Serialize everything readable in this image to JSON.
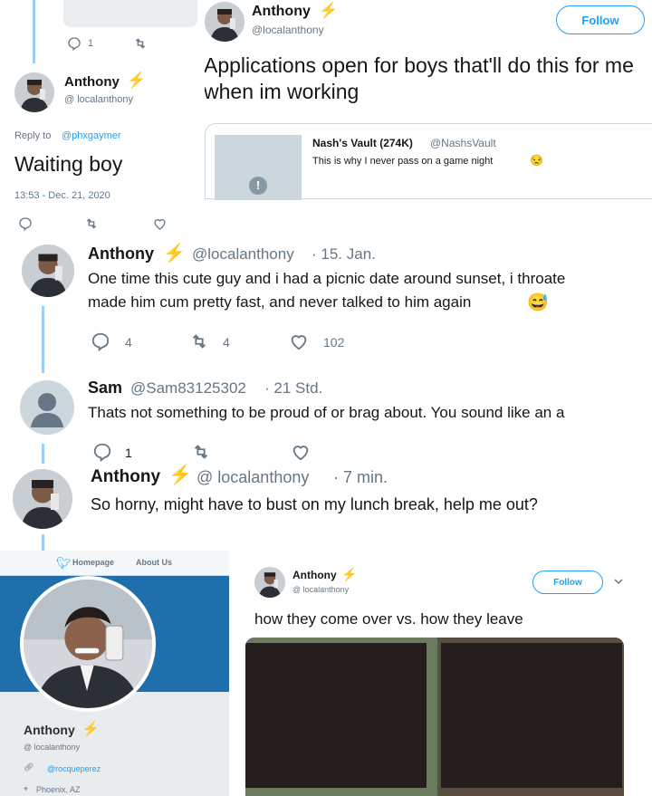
{
  "top_left": {
    "reply_count": "1"
  },
  "tweet1": {
    "name": "Anthony",
    "bolt": "⚡",
    "handle": "@localanthony",
    "follow": "Follow",
    "text": "Applications open for boys that'll do this for me when im working",
    "quote": {
      "name": "Nash's Vault (274K)",
      "handle": "@NashsVault",
      "text": "This is why I never pass on a game night",
      "emoji": "😒"
    }
  },
  "tweet2": {
    "name": "Anthony",
    "bolt": "⚡",
    "handle": "@ localanthony",
    "reply_label": "Reply to",
    "reply_to": "@phxgaymer",
    "text": "Waiting boy",
    "timestamp": "13:53 - Dec. 21, 2020"
  },
  "tweet3": {
    "name": "Anthony",
    "bolt": "⚡",
    "handle": "@localanthony",
    "time": "· 15. Jan.",
    "text_line1": "One time this cute guy and i had a picnic date around sunset, i throate",
    "text_line2": "made him cum pretty fast, and never talked to him again",
    "emoji": "😅",
    "replies": "4",
    "retweets": "4",
    "likes": "102"
  },
  "tweet4": {
    "name": "Sam",
    "handle": "@Sam83125302",
    "time": "· 21 Std.",
    "text": "Thats not something to be proud of or brag about. You sound like an a",
    "replies": "1"
  },
  "tweet5": {
    "name": "Anthony",
    "bolt": "⚡",
    "handle": "@ localanthony",
    "time": "· 7 min.",
    "text": "So horny, might have to bust on my lunch break, help me out?"
  },
  "profile": {
    "nav_home": "Homepage",
    "nav_about": "About Us",
    "name": "Anthony",
    "bolt": "⚡",
    "handle": "@ localanthony",
    "link": "@rocqueperez",
    "location": "Phoenix, AZ"
  },
  "tweet6": {
    "name": "Anthony",
    "bolt": "⚡",
    "handle": "@ localanthony",
    "follow": "Follow",
    "text": "how they come over vs. how they leave"
  },
  "colors": {
    "twitter_blue": "#1da1f2",
    "bolt": "#f5a623",
    "muted": "#657786"
  }
}
